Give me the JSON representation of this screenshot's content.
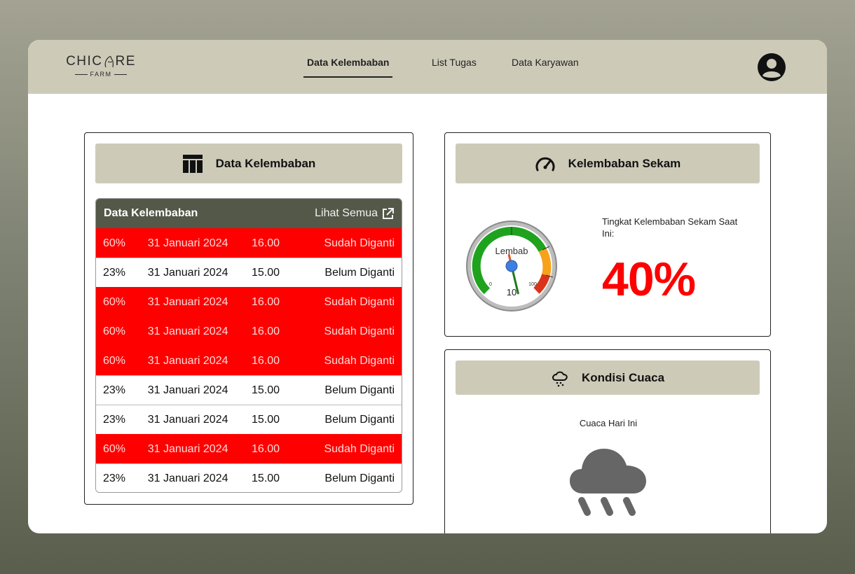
{
  "brand": {
    "name_left": "CHIC",
    "name_right": "RE",
    "sub": "FARM"
  },
  "nav": {
    "items": [
      {
        "label": "Data Kelembaban",
        "active": true
      },
      {
        "label": "List Tugas",
        "active": false
      },
      {
        "label": "Data Karyawan",
        "active": false
      }
    ]
  },
  "humidity_table": {
    "card_title": "Data Kelembaban",
    "table_title": "Data Kelembaban",
    "see_all": "Lihat Semua",
    "rows": [
      {
        "value": "60%",
        "date": "31 Januari 2024",
        "time": "16.00",
        "status": "Sudah Diganti",
        "highlight": true
      },
      {
        "value": "23%",
        "date": "31 Januari 2024",
        "time": "15.00",
        "status": "Belum Diganti",
        "highlight": false
      },
      {
        "value": "60%",
        "date": "31 Januari 2024",
        "time": "16.00",
        "status": "Sudah Diganti",
        "highlight": true
      },
      {
        "value": "60%",
        "date": "31 Januari 2024",
        "time": "16.00",
        "status": "Sudah Diganti",
        "highlight": true
      },
      {
        "value": "60%",
        "date": "31 Januari 2024",
        "time": "16.00",
        "status": "Sudah Diganti",
        "highlight": true
      },
      {
        "value": "23%",
        "date": "31 Januari 2024",
        "time": "15.00",
        "status": "Belum Diganti",
        "highlight": false
      },
      {
        "value": "23%",
        "date": "31 Januari 2024",
        "time": "15.00",
        "status": "Belum Diganti",
        "highlight": false
      },
      {
        "value": "60%",
        "date": "31 Januari 2024",
        "time": "16.00",
        "status": "Sudah Diganti",
        "highlight": true
      },
      {
        "value": "23%",
        "date": "31 Januari 2024",
        "time": "15.00",
        "status": "Belum Diganti",
        "highlight": false
      }
    ]
  },
  "husk_humidity": {
    "card_title": "Kelembaban Sekam",
    "gauge": {
      "label": "Lembab",
      "min_label": "0",
      "max_label": "100",
      "value_label": "10",
      "needle_fraction": 0.45
    },
    "caption": "Tingkat Kelembaban Sekam Saat Ini:",
    "value": "40%"
  },
  "weather": {
    "card_title": "Kondisi Cuaca",
    "caption": "Cuaca Hari Ini",
    "icon": "rain-cloud-icon"
  },
  "colors": {
    "navbar": "#cdcbb8",
    "table_header": "#545849",
    "highlight_row": "#ff0000",
    "value_red": "#ff0000"
  }
}
